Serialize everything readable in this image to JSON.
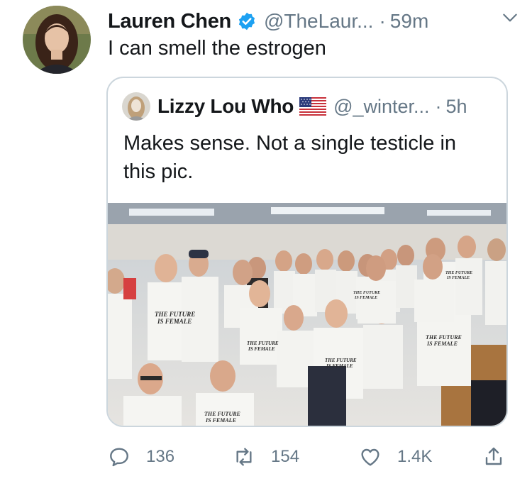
{
  "tweet": {
    "author_name": "Lauren Chen",
    "handle": "@TheLaur...",
    "separator": "·",
    "time": "59m",
    "text": "I can smell the estrogen"
  },
  "quote": {
    "author_name": "Lizzy Lou Who",
    "handle": "@_winter...",
    "separator": "·",
    "time": "5h",
    "text": "Makes sense. Not a single testicle in this pic.",
    "shirt_text_1": "THE FUTURE",
    "shirt_text_2": "IS FEMALE"
  },
  "actions": {
    "reply_count": "136",
    "retweet_count": "154",
    "like_count": "1.4K"
  },
  "icons": [
    "verified-icon",
    "chevron-down-icon",
    "us-flag-icon",
    "reply-icon",
    "retweet-icon",
    "like-icon",
    "share-icon"
  ],
  "colors": {
    "verified": "#1da1f2",
    "muted": "#657786",
    "border": "#ccd6dd"
  }
}
